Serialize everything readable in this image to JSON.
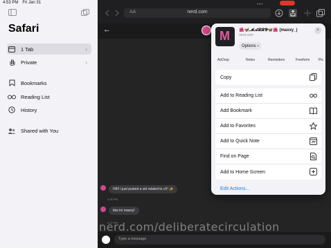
{
  "status": {
    "time": "4:53 PM",
    "date": "Fri Jan 31"
  },
  "sidebar": {
    "title": "Safari",
    "items": [
      {
        "label": "1 Tab",
        "icon": "tabs-icon"
      },
      {
        "label": "Private",
        "icon": "hand-icon"
      },
      {
        "label": "Bookmarks",
        "icon": "bookmark-icon"
      },
      {
        "label": "Reading List",
        "icon": "glasses-icon"
      },
      {
        "label": "History",
        "icon": "clock-icon"
      },
      {
        "label": "Shared with You",
        "icon": "people-icon"
      }
    ]
  },
  "toolbar": {
    "aa": "AA",
    "host": "nerd.com"
  },
  "chat": {
    "messages": [
      {
        "text": "HIII! i just posted a vid related to u!!! ✨",
        "time": "4:26 PM"
      },
      {
        "text": "btw im maxxy!",
        "time": "4:27 PM"
      }
    ],
    "composer_placeholder": "Type a message"
  },
  "watermark": "nerd.com/deliberatecirculation",
  "share": {
    "title": "🌺🦋𝓜𝓐𝓧𝓧𝓨🦋🌺 (maxxy_)",
    "subtitle": "nerd.com",
    "options": "Options",
    "apps": [
      "AirDrop",
      "Notes",
      "Reminders",
      "Freeform",
      "Pic"
    ],
    "group1": [
      {
        "label": "Copy",
        "icon": "copy-icon"
      }
    ],
    "group2": [
      {
        "label": "Add to Reading List",
        "icon": "glasses-icon"
      },
      {
        "label": "Add Bookmark",
        "icon": "book-icon"
      },
      {
        "label": "Add to Favorites",
        "icon": "star-icon"
      },
      {
        "label": "Add to Quick Note",
        "icon": "quick-note-icon"
      },
      {
        "label": "Find on Page",
        "icon": "find-icon"
      },
      {
        "label": "Add to Home Screen",
        "icon": "add-square-icon"
      }
    ],
    "edit_actions": "Edit Actions..."
  }
}
